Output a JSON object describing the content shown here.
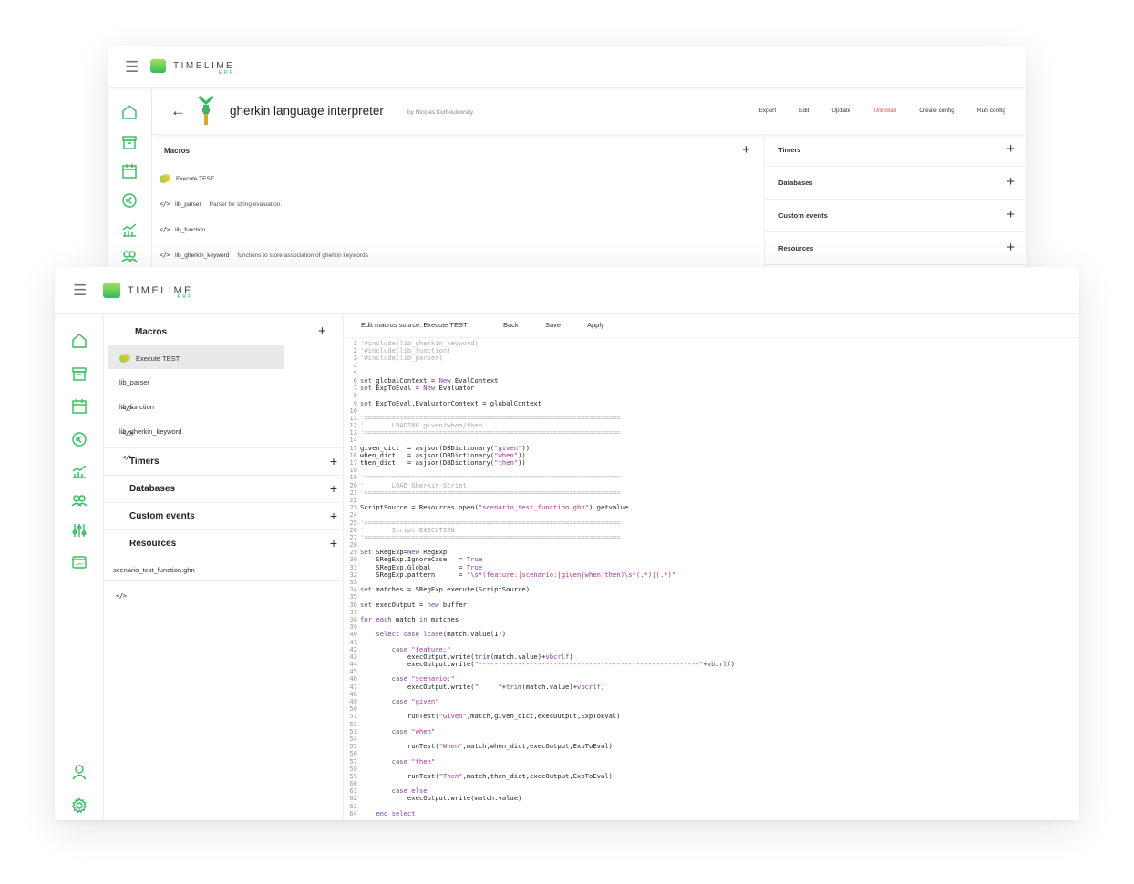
{
  "back": {
    "logo": {
      "word": "TIMELIME",
      "sub": "ERP"
    },
    "title": "gherkin language interpreter",
    "author": "by Nicolas Korboulewsky",
    "actions": [
      "Export",
      "Edit",
      "Update",
      "Uninstall",
      "Create config",
      "Run config"
    ],
    "macros_label": "Macros",
    "macros": [
      {
        "name": "Execute TEST",
        "desc": ""
      },
      {
        "name": "lib_parser",
        "desc": "Parser for string evaluation."
      },
      {
        "name": "lib_function",
        "desc": ""
      },
      {
        "name": "lib_gherkin_keyword",
        "desc": "functions to store association of gherkin keywords"
      }
    ],
    "right_panels": [
      "Timers",
      "Databases",
      "Custom events",
      "Resources"
    ],
    "plus": "+"
  },
  "front": {
    "logo": {
      "word": "TIMELIME",
      "sub": "ERP"
    },
    "macros_label": "Macros",
    "macros": [
      "Execute TEST",
      "lib_parser",
      "lib_function",
      "lib_gherkin_keyword"
    ],
    "groups": [
      "Timers",
      "Databases",
      "Custom events",
      "Resources"
    ],
    "resource_file": "scenario_test_function.ghn",
    "plus": "+",
    "editor": {
      "title": "Edit macros source: Execute TEST",
      "back": "Back",
      "save": "Save",
      "apply": "Apply"
    },
    "code_lines": [
      "'#include(lib_gherkin_keyword)",
      "'#include(lib_function)",
      "'#include(lib_parser)",
      "",
      "",
      "set globalContext = New EvalContext",
      "set ExpToEval = New Evaluator",
      "",
      "set ExpToEval.EvaluatorContext = globalContext",
      "",
      "'=================================================================",
      "'       LOADING given/when/then",
      "'=================================================================",
      "",
      "given_dict  = asjson(DBDictionary(\"given\"))",
      "when_dict   = asjson(DBDictionary(\"when\"))",
      "then_dict   = asjson(DBDictionary(\"then\"))",
      "",
      "'=================================================================",
      "'       LOAD Gherkin Script",
      "'=================================================================",
      "",
      "ScriptSource = Resources.open(\"scenario_test_function.ghn\").getvalue",
      "",
      "'=================================================================",
      "'       Script EXECUTION",
      "'=================================================================",
      "",
      "Set SRegExp=New RegExp",
      "    SRegExp.IgnoreCase   = True",
      "    SRegExp.Global       = True",
      "    SRegExp.pattern      = \"\\s*(feature:|scenario:|given|when|then)\\s*(.*)|(.*)\"",
      "",
      "set matches = SRegExp.execute(ScriptSource)",
      "",
      "set execOutput = new buffer",
      "",
      "for each match in matches",
      "",
      "    select case lcase(match.value(1))",
      "",
      "        case \"feature:\"",
      "            execOutput.write(trim(match.value)+vbcrlf)",
      "            execOutput.write(\"--------------------------------------------------------\"+vbcrlf)",
      "",
      "        case \"scenario:\"",
      "            execOutput.write(\"     \"+trim(match.value)+vbcrlf)",
      "",
      "        case \"given\"",
      "",
      "            runTest(\"Given\",match,given_dict,execOutput,ExpToEval)",
      "",
      "        case \"when\"",
      "",
      "            runTest(\"When\",match,when_dict,execOutput,ExpToEval)",
      "",
      "        case \"then\"",
      "",
      "            runTest(\"Then\",match,then_dict,execOutput,ExpToEval)",
      "",
      "        case else",
      "            execOutput.write(match.value)",
      "",
      "    end select"
    ]
  },
  "colors": {
    "accent": "#2fbd5b",
    "danger": "#e05050",
    "keyword": "#7a3fa0",
    "string": "#b03090",
    "comment": "#aaaaaa"
  }
}
